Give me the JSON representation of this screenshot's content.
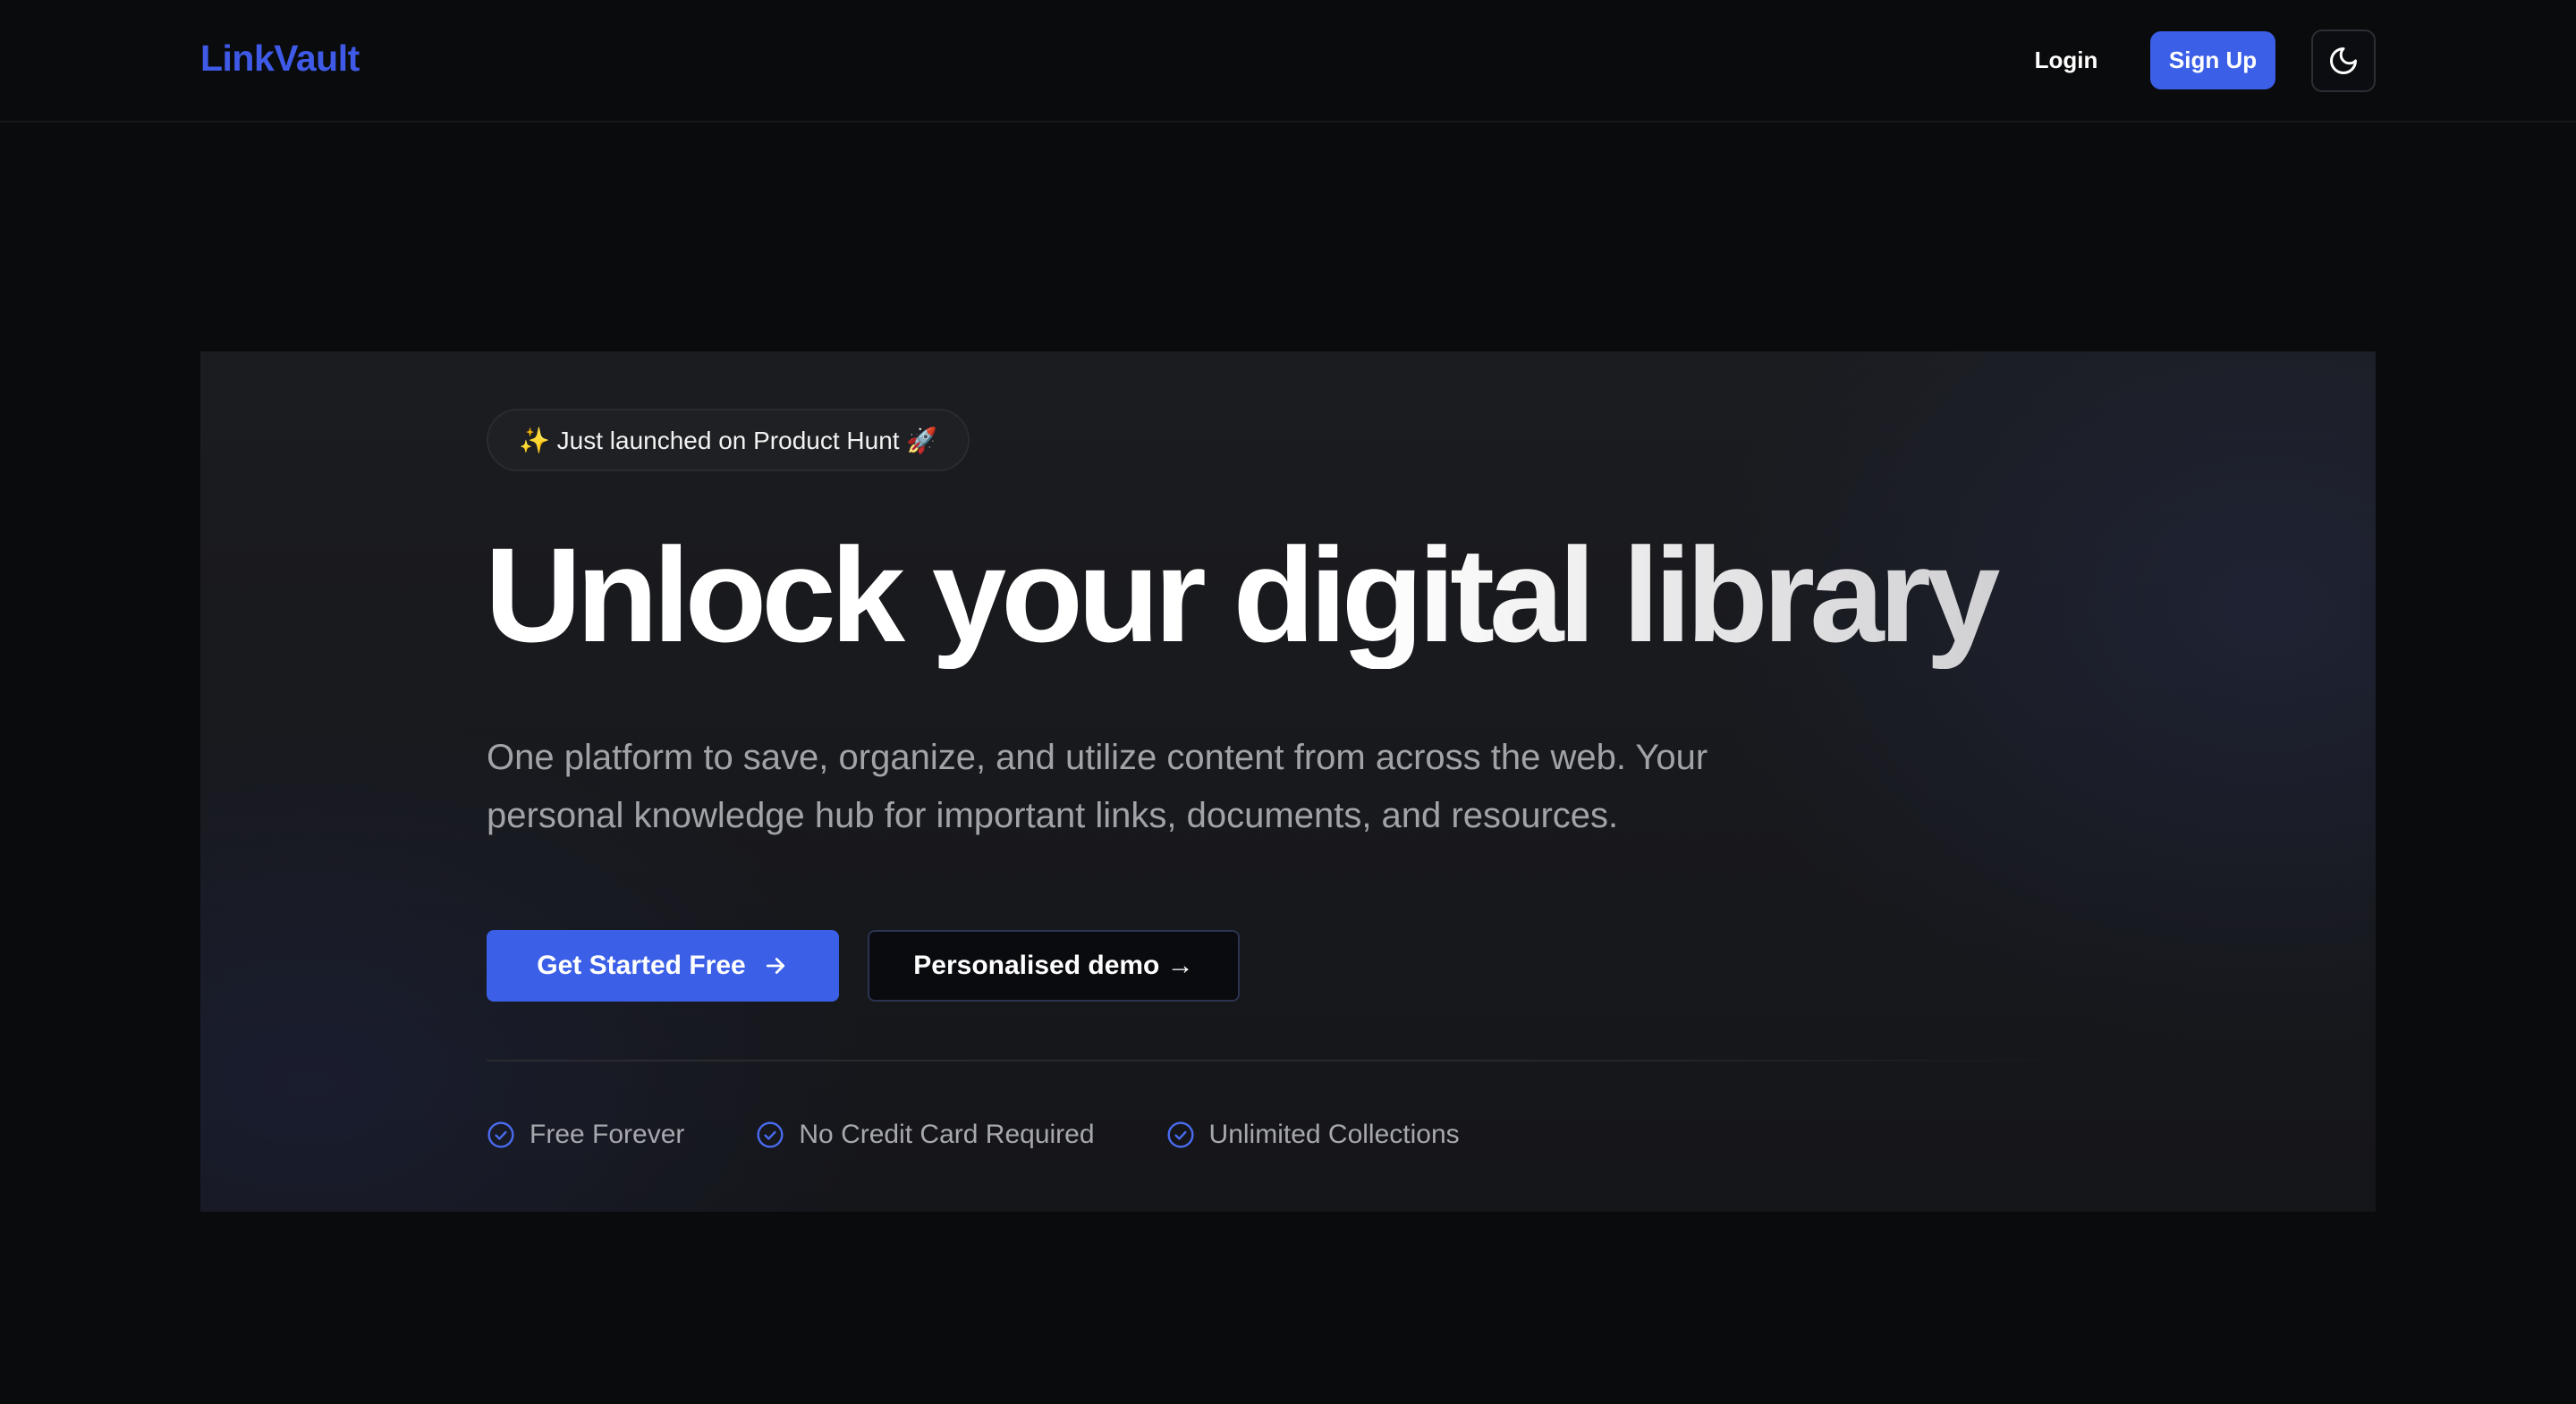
{
  "header": {
    "logo": "LinkVault",
    "login_label": "Login",
    "signup_label": "Sign Up",
    "theme_icon": "moon-icon"
  },
  "hero": {
    "badge_text": "✨ Just launched on Product Hunt 🚀",
    "headline": "Unlock your digital library",
    "subtext": "One platform to save, organize, and utilize content from across the web. Your personal knowledge hub for important links, documents, and resources.",
    "primary_cta": "Get Started Free",
    "secondary_cta": "Personalised demo →",
    "features": [
      {
        "label": "Free Forever",
        "icon": "check-circle-icon"
      },
      {
        "label": "No Credit Card Required",
        "icon": "check-circle-icon"
      },
      {
        "label": "Unlimited Collections",
        "icon": "check-circle-icon"
      }
    ]
  },
  "colors": {
    "background": "#0a0b0d",
    "brand": "#3b5fe6",
    "card": "#1b1c20",
    "muted_text": "#a2a3a8"
  }
}
